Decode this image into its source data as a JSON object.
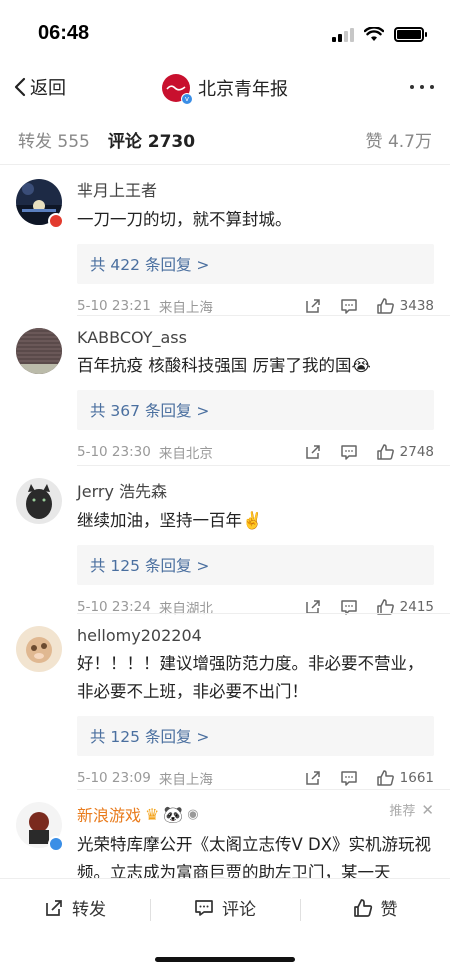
{
  "status": {
    "time": "06:48"
  },
  "nav": {
    "back_label": "返回",
    "title": "北京青年报"
  },
  "tabs": {
    "repost": "转发 555",
    "comment": "评论 2730",
    "like": "赞 4.7万"
  },
  "comments": [
    {
      "username": "芈月上王者",
      "content": "一刀一刀的切，就不算封城。",
      "replies": "共 422 条回复 >",
      "time": "5-10 23:21",
      "location": "来自上海",
      "likes": "3438"
    },
    {
      "username": "KABBCOY_ass",
      "content": "百年抗疫  核酸科技强国 厉害了我的国😭",
      "replies": "共 367 条回复 >",
      "time": "5-10 23:30",
      "location": "来自北京",
      "likes": "2748"
    },
    {
      "username": "Jerry 浩先森",
      "content": "继续加油，坚持一百年✌️",
      "replies": "共 125 条回复 >",
      "time": "5-10 23:24",
      "location": "来自湖北",
      "likes": "2415"
    },
    {
      "username": "hellomy202204",
      "content": "好！！！！建议增强防范力度。非必要不营业，非必要不上班，非必要不出门！",
      "replies": "共 125 条回复 >",
      "time": "5-10 23:09",
      "location": "来自上海",
      "likes": "1661"
    },
    {
      "username": "新浪游戏",
      "content": "光荣特库摩公开《太阁立志传V DX》实机游玩视频。立志成为富商巨贾的助左卫门，某一天",
      "recommend": "推荐"
    }
  ],
  "bottom": {
    "repost": "转发",
    "comment": "评论",
    "like": "赞"
  },
  "colors": {
    "link": "#4a6f9f",
    "accent_orange": "#e97c1e",
    "brand_red": "#c8102e"
  }
}
